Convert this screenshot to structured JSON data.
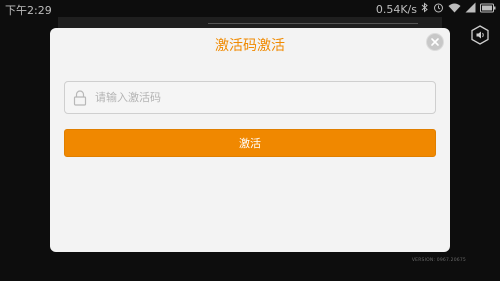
{
  "status_bar": {
    "time": "下午2:29",
    "network_speed": "0.54K/s",
    "icons": [
      "bluetooth-icon",
      "alarm-icon",
      "wifi-icon",
      "signal-icon",
      "battery-icon"
    ]
  },
  "dialog": {
    "title": "激活码激活",
    "close_icon": "close-icon",
    "input": {
      "placeholder": "请输入激活码",
      "value": "",
      "icon": "lock-icon"
    },
    "activate_label": "激活"
  },
  "sound_icon": "speaker-icon",
  "version": "VERSION: 0967.20675",
  "colors": {
    "accent": "#f08800",
    "title": "#f08a00",
    "dialog_bg": "#f3f3f3",
    "backdrop": "#0d0d0d"
  }
}
